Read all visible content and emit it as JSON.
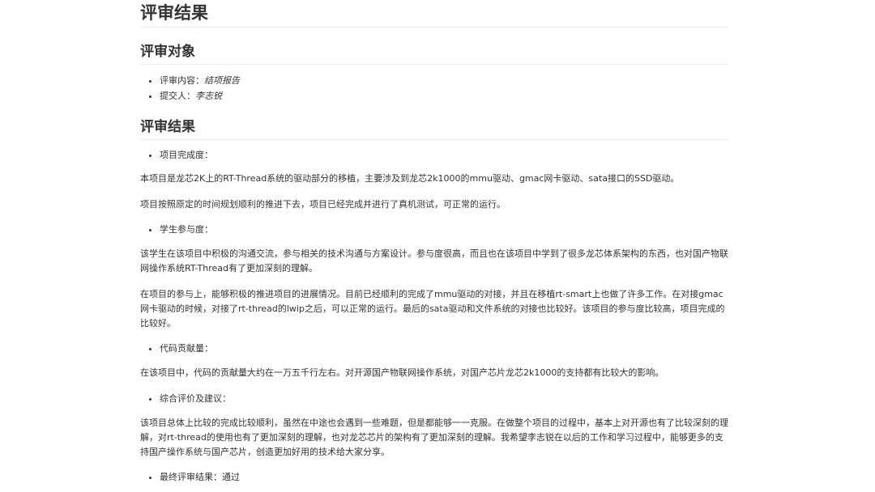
{
  "title": "评审结果",
  "review_object": {
    "heading": "评审对象",
    "items": [
      {
        "label": "评审内容：",
        "value": "结项报告"
      },
      {
        "label": "提交人：",
        "value": "李志锐"
      }
    ]
  },
  "review_result": {
    "heading": "评审结果",
    "completion": {
      "label": "项目完成度：",
      "paragraphs": [
        "本项目是龙芯2K上的RT-Thread系统的驱动部分的移植，主要涉及到龙芯2k1000的mmu驱动、gmac网卡驱动、sata接口的SSD驱动。",
        "项目按照原定的时间规划顺利的推进下去，项目已经完成并进行了真机测试，可正常的运行。"
      ]
    },
    "participation": {
      "label": "学生参与度：",
      "paragraphs": [
        "该学生在该项目中积极的沟通交流，参与相关的技术沟通与方案设计。参与度很高，而且也在该项目中学到了很多龙芯体系架构的东西，也对国产物联网操作系统RT-Thread有了更加深刻的理解。",
        "在项目的参与上，能够积极的推进项目的进展情况。目前已经顺利的完成了mmu驱动的对接，并且在移植rt-smart上也做了许多工作。在对接gmac网卡驱动的时候，对接了rt-thread的lwip之后，可以正常的运行。最后的sata驱动和文件系统的对接也比较好。该项目的参与度比较高，项目完成的比较好。"
      ]
    },
    "contribution": {
      "label": "代码贡献量：",
      "paragraphs": [
        "在该项目中，代码的贡献量大约在一万五千行左右。对开源国产物联网操作系统，对国产芯片龙芯2k1000的支持都有比较大的影响。"
      ]
    },
    "evaluation": {
      "label": "综合评价及建议：",
      "paragraphs": [
        "该项目总体上比较的完成比较顺利，虽然在中途也会遇到一些难题，但是都能够一一克服。在做整个项目的过程中，基本上对开源也有了比较深刻的理解，对rt-thread的使用也有了更加深刻的理解，也对龙芯芯片的架构有了更加深刻的理解。我希望李志锐在以后的工作和学习过程中，能够更多的支持国产操作系统与国产芯片，创造更加好用的技术给大家分享。"
      ]
    },
    "final": {
      "label": "最终评审结果：",
      "value": "通过"
    }
  }
}
